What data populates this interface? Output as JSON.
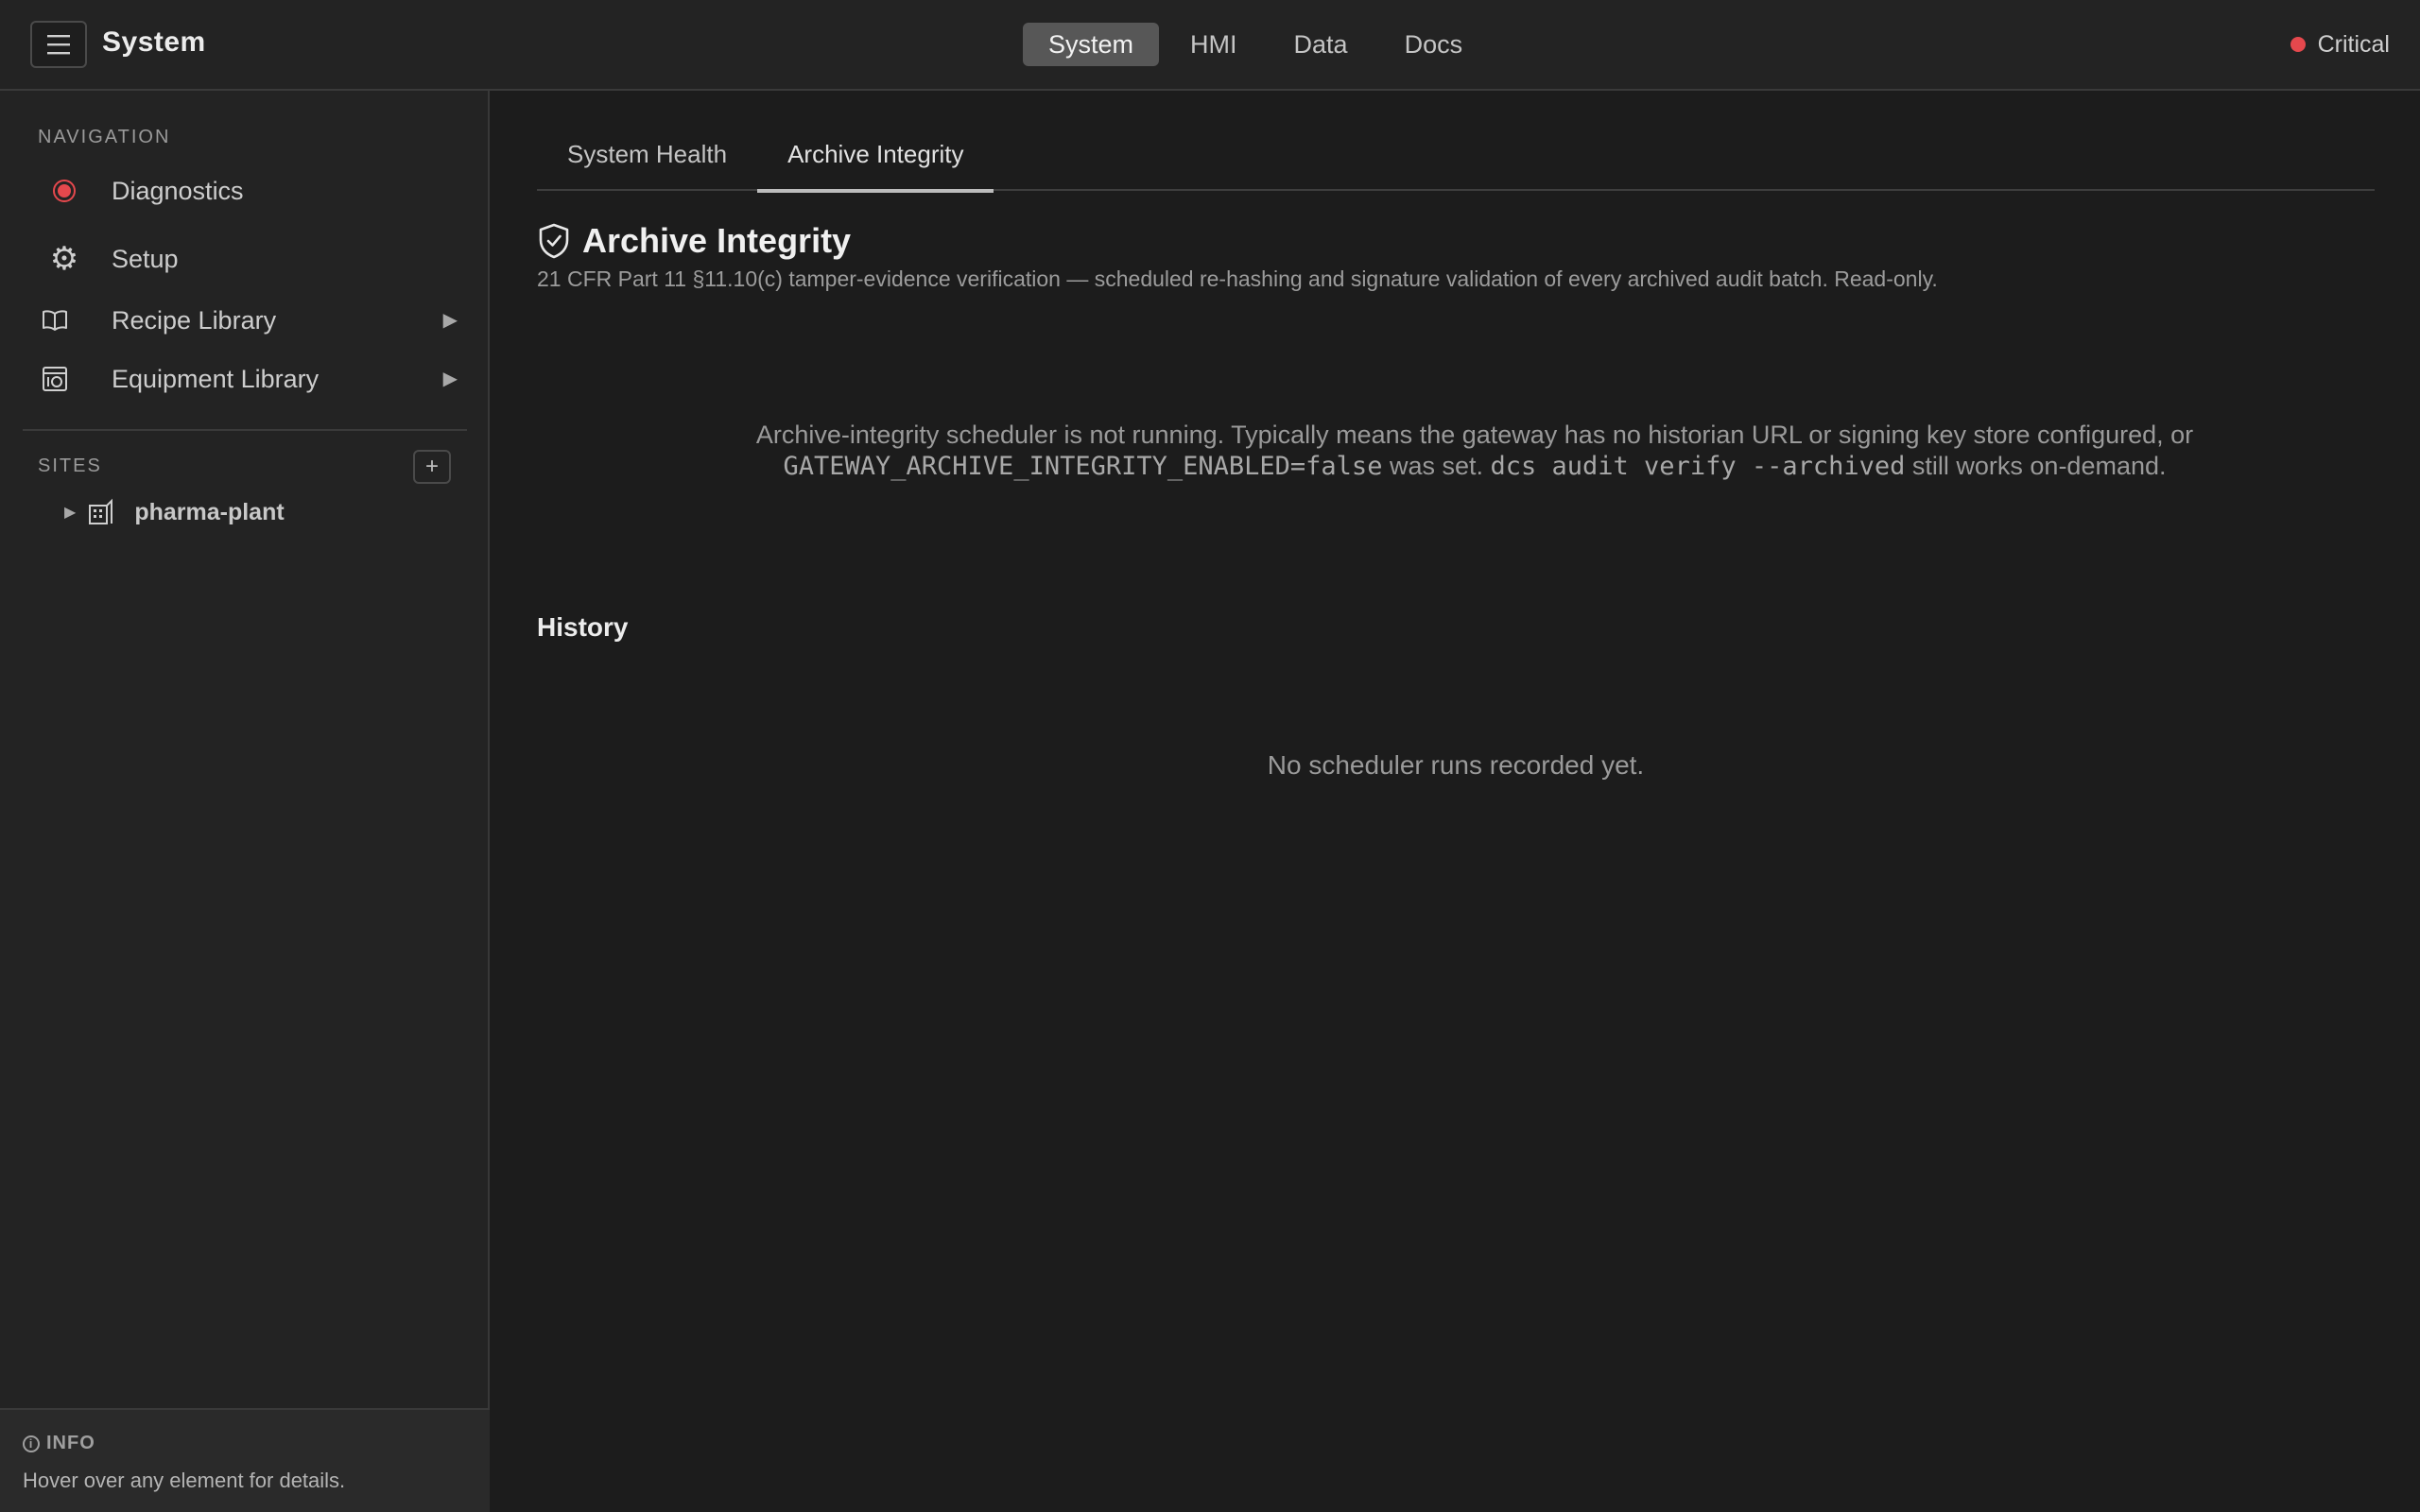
{
  "app": {
    "title": "System",
    "nav_tabs": [
      "System",
      "HMI",
      "Data",
      "Docs"
    ],
    "active_nav": "System",
    "status": {
      "label": "Critical",
      "color": "#e5484d"
    }
  },
  "sidebar": {
    "navigation_label": "Navigation",
    "items": [
      {
        "label": "Diagnostics",
        "icon": "diagnostics-record-icon",
        "icon_color": "#e5484d"
      },
      {
        "label": "Setup",
        "icon": "gear-icon"
      },
      {
        "label": "Recipe Library",
        "icon": "book-icon",
        "expandable": true
      },
      {
        "label": "Equipment Library",
        "icon": "equipment-icon",
        "expandable": true
      }
    ],
    "sites_label": "Sites",
    "add_site_label": "+",
    "sites": [
      {
        "label": "pharma-plant",
        "icon": "building-icon"
      }
    ],
    "info": {
      "title": "INFO",
      "text": "Hover over any element for details."
    }
  },
  "main": {
    "tabs": [
      "System Health",
      "Archive Integrity"
    ],
    "active_tab": "Archive Integrity",
    "heading": "Archive Integrity",
    "subtitle": "21 CFR Part 11 §11.10(c) tamper-evidence verification — scheduled re-hashing and signature validation of every archived audit batch. Read-only.",
    "notice": {
      "part1": "Archive-integrity scheduler is not running. Typically means the gateway has no historian URL or signing key store configured, or",
      "code1": "GATEWAY_ARCHIVE_INTEGRITY_ENABLED=false",
      "part2": " was set. ",
      "code2": "dcs audit verify --archived",
      "part3": " still works on-demand."
    },
    "history_title": "History",
    "history_empty": "No scheduler runs recorded yet."
  }
}
